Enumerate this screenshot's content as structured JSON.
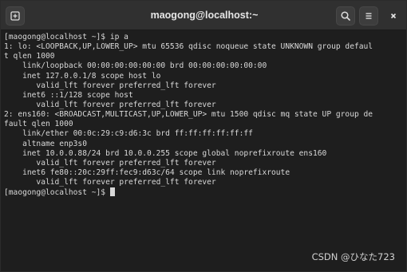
{
  "window": {
    "title": "maogong@localhost:~"
  },
  "titlebar": {
    "new_tab_icon": "new-tab-icon",
    "search_icon": "search-icon",
    "menu_icon": "hamburger-menu-icon",
    "close_icon": "close-icon"
  },
  "terminal": {
    "lines": [
      "[maogong@localhost ~]$ ip a",
      "1: lo: <LOOPBACK,UP,LOWER_UP> mtu 65536 qdisc noqueue state UNKNOWN group defaul",
      "t qlen 1000",
      "    link/loopback 00:00:00:00:00:00 brd 00:00:00:00:00:00",
      "    inet 127.0.0.1/8 scope host lo",
      "       valid_lft forever preferred_lft forever",
      "    inet6 ::1/128 scope host",
      "       valid_lft forever preferred_lft forever",
      "2: ens160: <BROADCAST,MULTICAST,UP,LOWER_UP> mtu 1500 qdisc mq state UP group de",
      "fault qlen 1000",
      "    link/ether 00:0c:29:c9:d6:3c brd ff:ff:ff:ff:ff:ff",
      "    altname enp3s0",
      "    inet 10.0.0.88/24 brd 10.0.0.255 scope global noprefixroute ens160",
      "       valid_lft forever preferred_lft forever",
      "    inet6 fe80::20c:29ff:fec9:d63c/64 scope link noprefixroute",
      "       valid_lft forever preferred_lft forever",
      "[maogong@localhost ~]$ "
    ]
  },
  "watermark": {
    "text": "CSDN @ひなた723"
  },
  "colors": {
    "background": "#1e1e1e",
    "titlebar": "#303030",
    "text": "#d8d8d8"
  }
}
